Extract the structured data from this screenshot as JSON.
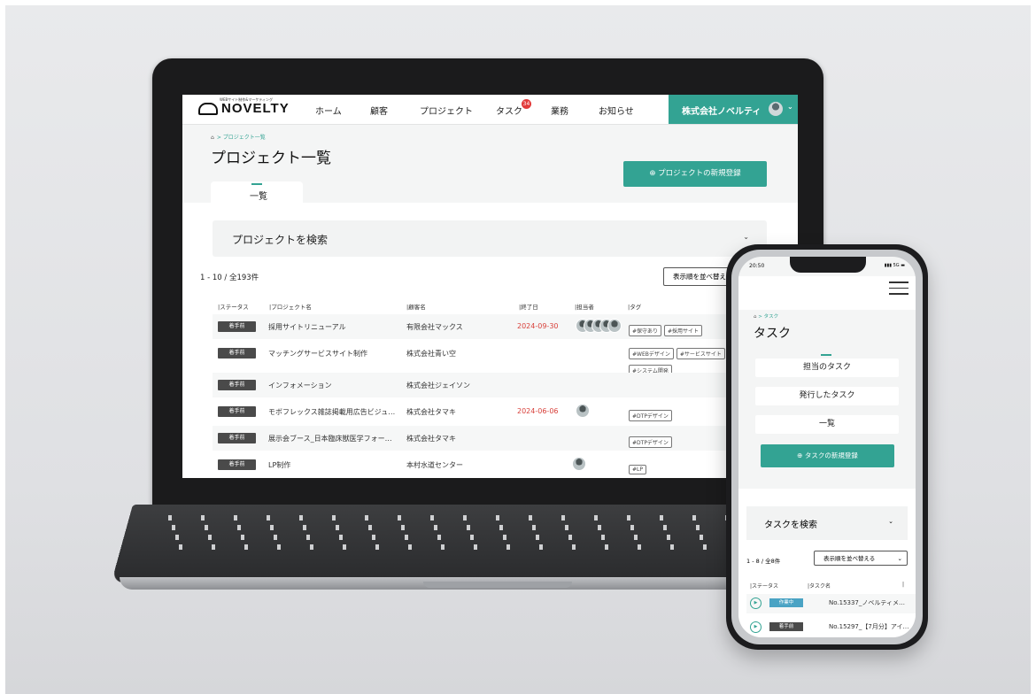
{
  "laptop": {
    "logo": {
      "text": "NOVELTY",
      "tagline": "WEBサイト制作&マーケティング"
    },
    "nav": {
      "items": [
        "ホーム",
        "顧客",
        "プロジェクト",
        "タスク",
        "業務",
        "お知らせ"
      ],
      "task_badge": "34",
      "company": "株式会社ノベルティ"
    },
    "breadcrumb": {
      "current": "プロジェクト一覧"
    },
    "page_title": "プロジェクト一覧",
    "tab_label": "一覧",
    "new_button": "プロジェクトの新規登録",
    "search_label": "プロジェクトを検索",
    "count_text": "1 - 10 / 全193件",
    "sort_button": "表示順を並べ替え",
    "columns": [
      "ステータス",
      "プロジェクト名",
      "顧客名",
      "終了日",
      "担当者",
      "タグ"
    ],
    "rows": [
      {
        "status": "着手前",
        "name": "採用サイトリニューアル",
        "client": "有限会社マックス",
        "end": "2024-09-30",
        "tags": [
          "#保守あり",
          "#採用サイト"
        ]
      },
      {
        "status": "着手前",
        "name": "マッチングサービスサイト制作",
        "client": "株式会社青い空",
        "end": "",
        "tags": [
          "#WEBデザイン",
          "#サービスサイト",
          "#システム開発"
        ]
      },
      {
        "status": "着手前",
        "name": "インフォメーション",
        "client": "株式会社ジェイソン",
        "end": "",
        "tags": []
      },
      {
        "status": "着手前",
        "name": "モボフレックス雑誌掲載用広告ビジュ…",
        "client": "株式会社タマキ",
        "end": "2024-06-06",
        "tags": [
          "#DTPデザイン"
        ]
      },
      {
        "status": "着手前",
        "name": "展示会ブース_日本臨床獣医学フォー…",
        "client": "株式会社タマキ",
        "end": "",
        "tags": [
          "#DTPデザイン"
        ]
      },
      {
        "status": "着手前",
        "name": "LP制作",
        "client": "本村水道センター",
        "end": "",
        "tags": [
          "#LP"
        ]
      }
    ]
  },
  "phone": {
    "status_time": "20:50",
    "status_signal": "5G",
    "breadcrumb": {
      "current": "タスク"
    },
    "page_title": "タスク",
    "tabs": [
      "担当のタスク",
      "発行したタスク",
      "一覧"
    ],
    "new_button": "タスクの新規登録",
    "search_label": "タスクを検索",
    "count_text": "1 - 8 / 全8件",
    "sort_select": "表示順を並べ替える",
    "columns": [
      "ステータス",
      "タスク名"
    ],
    "rows": [
      {
        "status": "作業中",
        "name": "No.15337_ノベルティメ…",
        "status_color": "#4aa3c4"
      },
      {
        "status": "着手前",
        "name": "No.15297_【7月分】アイ…",
        "status_color": "#4a4a4a"
      }
    ]
  },
  "colors": {
    "accent": "#33a393",
    "date_red": "#d8403a",
    "badge_red": "#e23a3a"
  }
}
